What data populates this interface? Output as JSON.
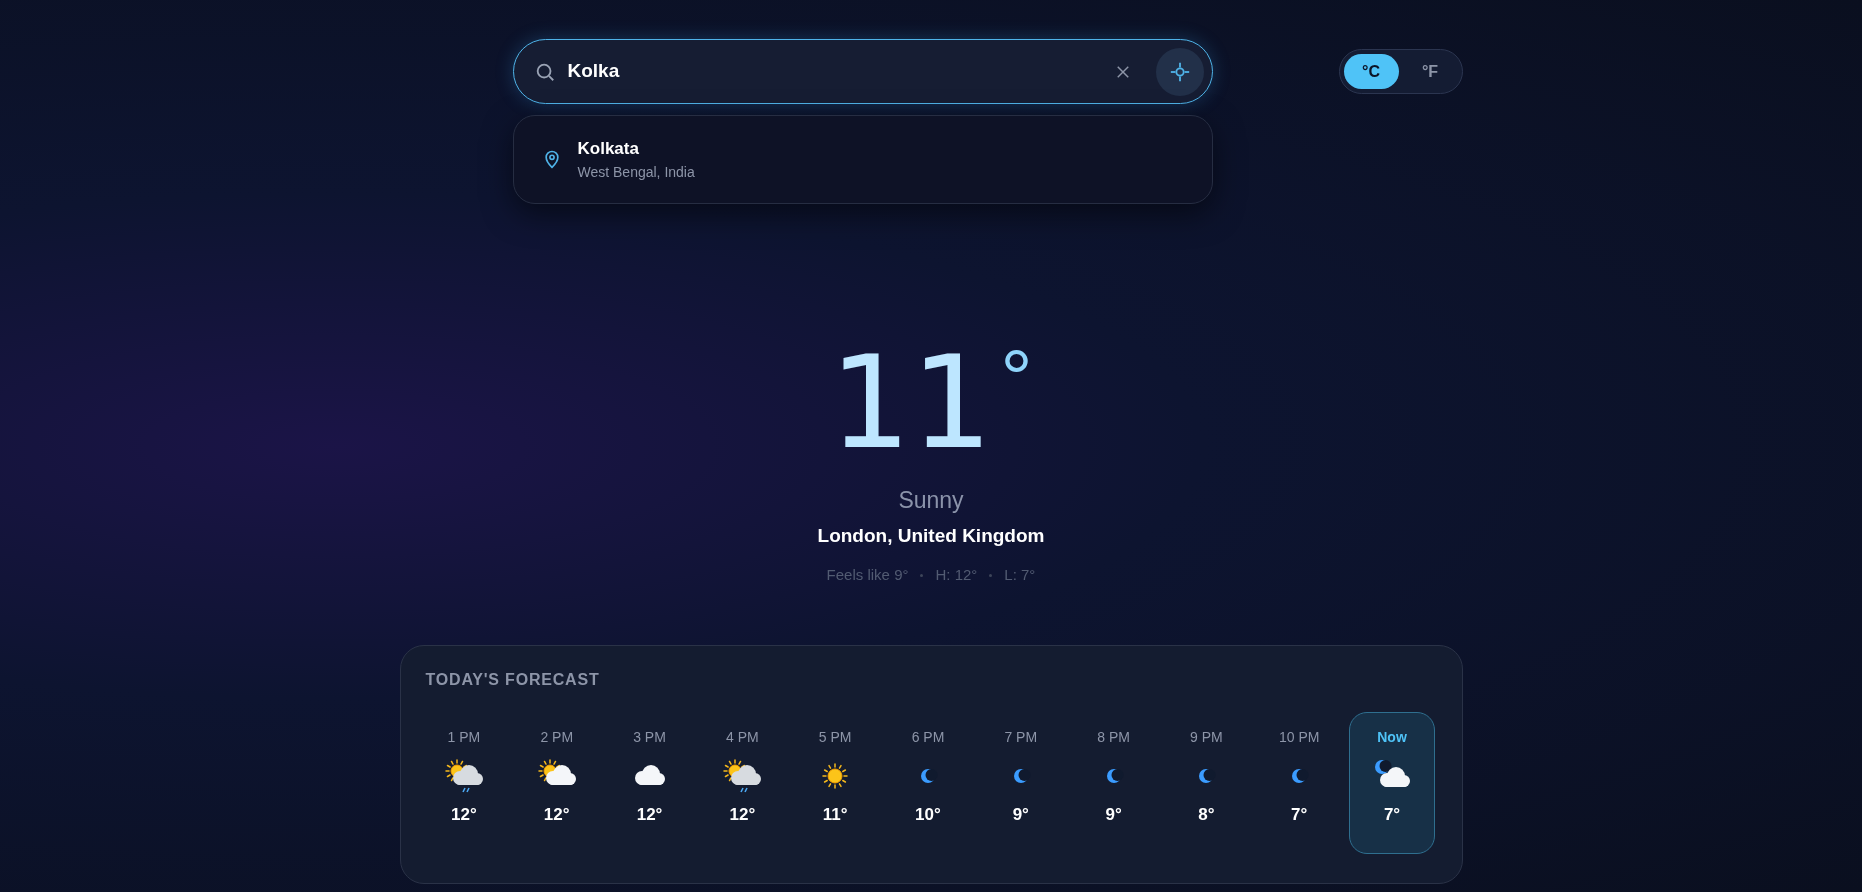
{
  "search": {
    "value": "Kolka"
  },
  "suggestions": [
    {
      "name": "Kolkata",
      "region": "West Bengal, India",
      "selected": false
    }
  ],
  "units": [
    {
      "label": "°C",
      "selected": true
    },
    {
      "label": "°F",
      "selected": false
    }
  ],
  "current": {
    "temperature": "11",
    "degree": "°",
    "condition": "Sunny",
    "location": "London, United Kingdom",
    "details": [
      "Feels like 9°",
      "H: 12°",
      "L: 7°"
    ]
  },
  "forecast": {
    "title": "TODAY'S FORECAST",
    "hours": [
      {
        "time": "1 PM",
        "kind": "sun-cloud-rain",
        "temp": "12°",
        "selected": false
      },
      {
        "time": "2 PM",
        "kind": "sun-cloud",
        "temp": "12°",
        "selected": false
      },
      {
        "time": "3 PM",
        "kind": "cloud",
        "temp": "12°",
        "selected": false
      },
      {
        "time": "4 PM",
        "kind": "sun-cloud-rain",
        "temp": "12°",
        "selected": false
      },
      {
        "time": "5 PM",
        "kind": "sun",
        "temp": "11°",
        "selected": false
      },
      {
        "time": "6 PM",
        "kind": "moon",
        "temp": "10°",
        "selected": false
      },
      {
        "time": "7 PM",
        "kind": "moon",
        "temp": "9°",
        "selected": false
      },
      {
        "time": "8 PM",
        "kind": "moon",
        "temp": "9°",
        "selected": false
      },
      {
        "time": "9 PM",
        "kind": "moon",
        "temp": "8°",
        "selected": false
      },
      {
        "time": "10 PM",
        "kind": "moon",
        "temp": "7°",
        "selected": false
      },
      {
        "time": "Now",
        "kind": "moon-cloud",
        "temp": "7°",
        "selected": true
      }
    ]
  }
}
